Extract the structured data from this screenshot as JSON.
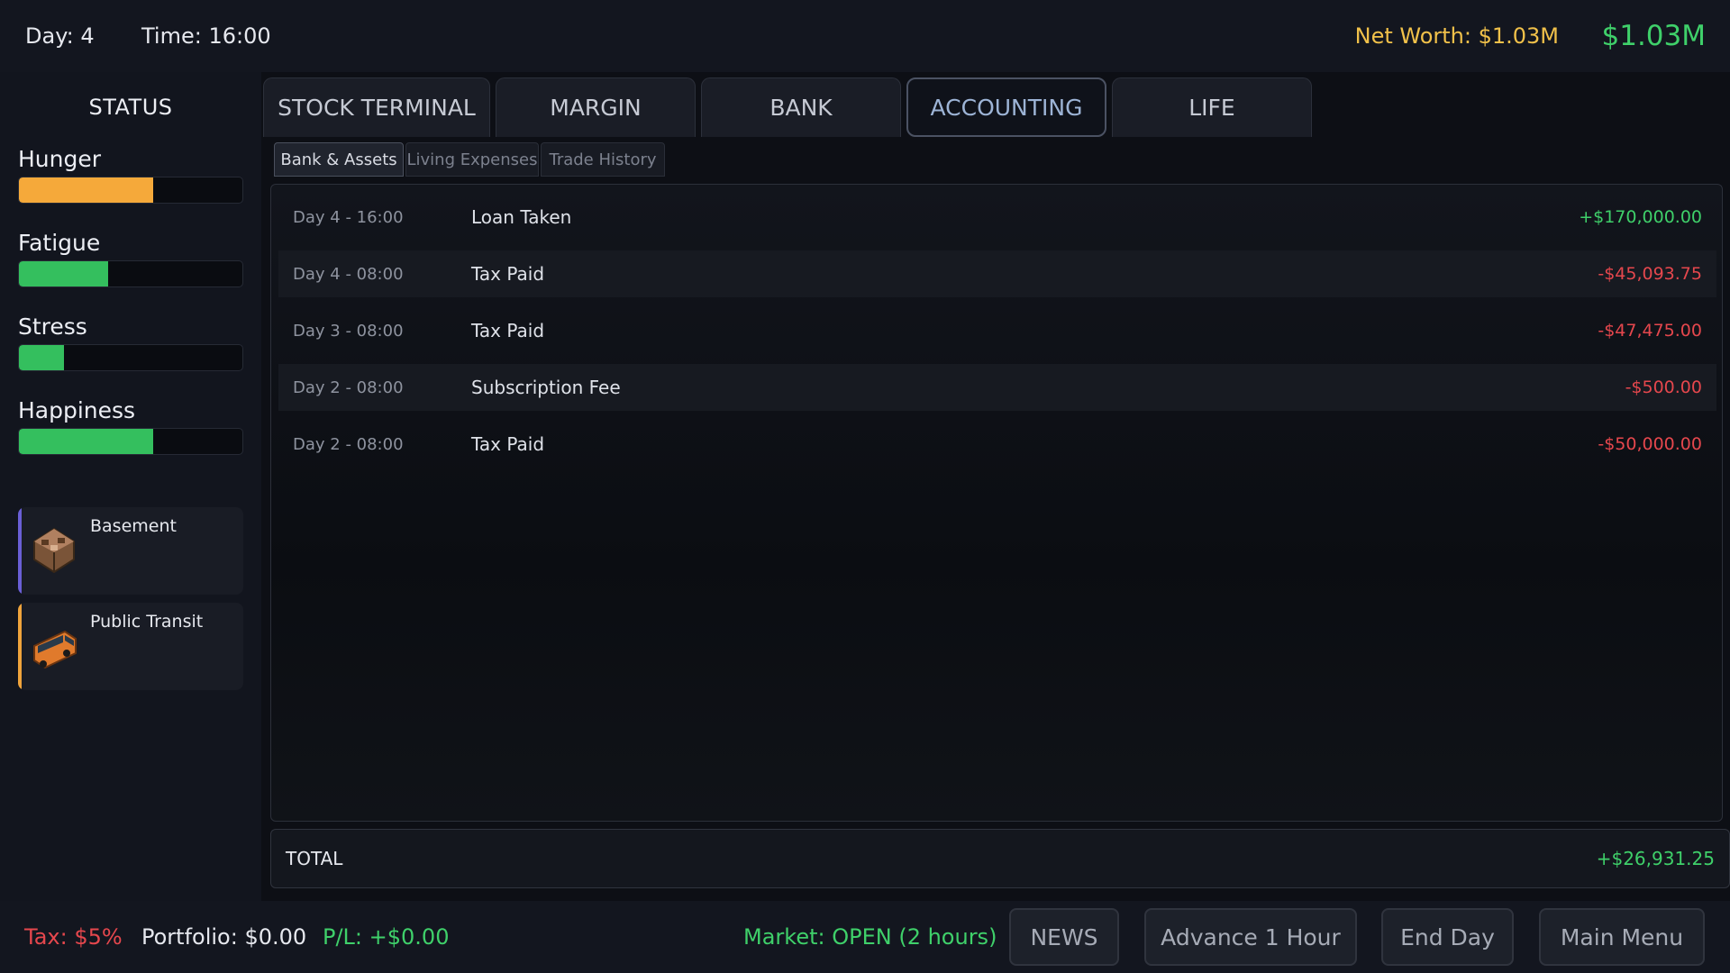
{
  "header": {
    "day": "Day: 4",
    "time": "Time: 16:00",
    "net_worth": "Net Worth: $1.03M",
    "cash": "$1.03M"
  },
  "sidebar": {
    "title": "STATUS",
    "stats": [
      {
        "label": "Hunger",
        "level": 0.6,
        "color": "#f5a93a"
      },
      {
        "label": "Fatigue",
        "level": 0.4,
        "color": "#34bf5e"
      },
      {
        "label": "Stress",
        "level": 0.2,
        "color": "#34bf5e"
      },
      {
        "label": "Happiness",
        "level": 0.6,
        "color": "#34bf5e"
      }
    ],
    "cards": [
      {
        "name": "Basement",
        "accent": "#6a5fd6",
        "icon": "basement-icon"
      },
      {
        "name": "Public Transit",
        "accent": "#f0a43c",
        "icon": "bus-icon"
      }
    ]
  },
  "tabs": [
    "STOCK TERMINAL",
    "MARGIN",
    "BANK",
    "ACCOUNTING",
    "LIFE"
  ],
  "active_tab": "ACCOUNTING",
  "subtabs": [
    "Bank & Assets",
    "Living Expenses",
    "Trade History"
  ],
  "active_subtab": "Bank & Assets",
  "transactions": [
    {
      "date": "Day 4 - 16:00",
      "desc": "Loan Taken",
      "amount": "+$170,000.00",
      "sign": "pos"
    },
    {
      "date": "Day 4 - 08:00",
      "desc": "Tax Paid",
      "amount": "-$45,093.75",
      "sign": "neg"
    },
    {
      "date": "Day 3 - 08:00",
      "desc": "Tax Paid",
      "amount": "-$47,475.00",
      "sign": "neg"
    },
    {
      "date": "Day 2 - 08:00",
      "desc": "Subscription Fee",
      "amount": "-$500.00",
      "sign": "neg"
    },
    {
      "date": "Day 2 - 08:00",
      "desc": "Tax Paid",
      "amount": "-$50,000.00",
      "sign": "neg"
    }
  ],
  "total": {
    "label": "TOTAL",
    "value": "+$26,931.25"
  },
  "footer": {
    "tax": "Tax: $5%",
    "portfolio": "Portfolio: $0.00",
    "pl": "P/L: +$0.00",
    "market": "Market: OPEN (2 hours)",
    "news": "NEWS",
    "advance": "Advance 1 Hour",
    "end_day": "End Day",
    "main_menu": "Main Menu"
  },
  "colors": {
    "positive": "#3fd06a",
    "negative": "#e5474d",
    "gold": "#f1c14a"
  }
}
